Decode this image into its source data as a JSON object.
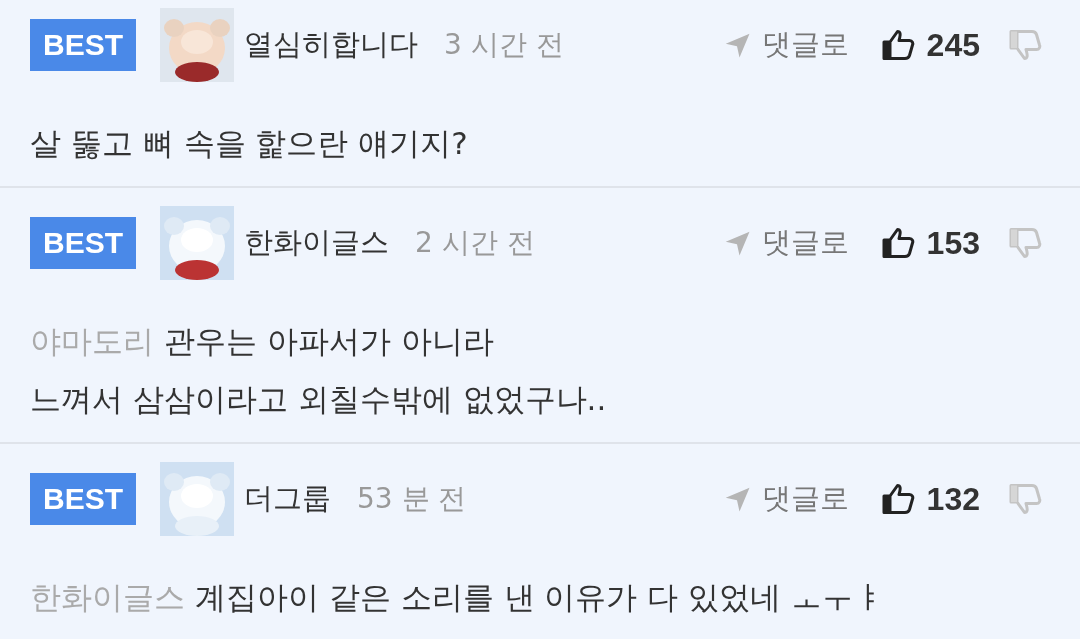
{
  "comments": [
    {
      "badge": "BEST",
      "author": "열심히합니다",
      "time": "3 시간 전",
      "reply": "댓글로",
      "likes": "245",
      "avatar": {
        "kind": "picture"
      },
      "lines": [
        "살 뚫고 뼈 속을 핥으란 얘기지?"
      ]
    },
    {
      "badge": "BEST",
      "author": "한화이글스",
      "time": "2 시간 전",
      "reply": "댓글로",
      "likes": "153",
      "avatar": {
        "kind": "picture"
      },
      "mention": "야마도리",
      "lines": [
        "관우는 아파서가 아니라",
        "느껴서 삼삼이라고 외칠수밖에 없었구나.."
      ]
    },
    {
      "badge": "BEST",
      "author": "더그룹",
      "time": "53 분 전",
      "reply": "댓글로",
      "likes": "132",
      "avatar": {
        "kind": "picture"
      },
      "mention": "한화이글스",
      "lines": [
        "계집아이 같은 소리를 낸 이유가 다 있었네 ㅗㅜㅑ"
      ]
    }
  ]
}
